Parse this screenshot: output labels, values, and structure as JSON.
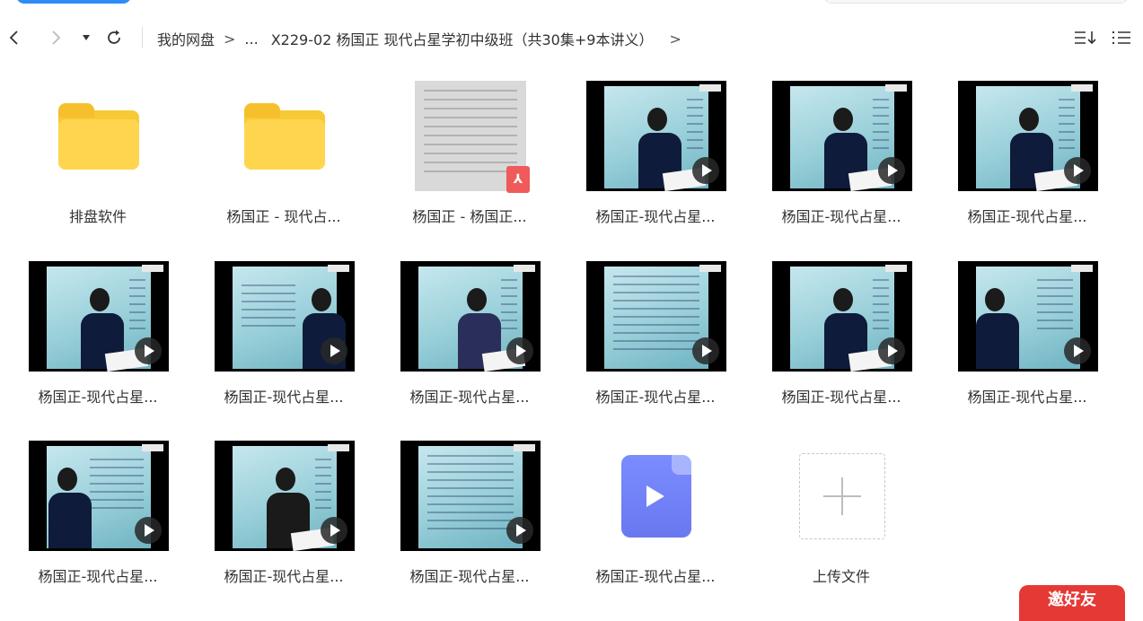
{
  "toolbar": {
    "breadcrumbs": [
      "我的网盘",
      "...",
      "X229-02 杨国正 现代占星学初中级班（共30集+9本讲义）"
    ],
    "crumb_separator": ">",
    "icons": [
      "chevron-left-icon",
      "chevron-right-icon",
      "caret-down-icon",
      "refresh-icon",
      "sort-icon",
      "list-view-icon"
    ]
  },
  "files": [
    {
      "type": "folder",
      "name": "排盘软件"
    },
    {
      "type": "folder",
      "name": "杨国正 - 现代占..."
    },
    {
      "type": "pdf",
      "name": "杨国正 - 杨国正..."
    },
    {
      "type": "video",
      "name": "杨国正-现代占星..."
    },
    {
      "type": "video",
      "name": "杨国正-现代占星..."
    },
    {
      "type": "video",
      "name": "杨国正-现代占星..."
    },
    {
      "type": "video",
      "name": "杨国正-现代占星..."
    },
    {
      "type": "video",
      "name": "杨国正-现代占星..."
    },
    {
      "type": "video",
      "name": "杨国正-现代占星..."
    },
    {
      "type": "video",
      "name": "杨国正-现代占星..."
    },
    {
      "type": "video",
      "name": "杨国正-现代占星..."
    },
    {
      "type": "video",
      "name": "杨国正-现代占星..."
    },
    {
      "type": "video",
      "name": "杨国正-现代占星..."
    },
    {
      "type": "video",
      "name": "杨国正-现代占星..."
    },
    {
      "type": "video",
      "name": "杨国正-现代占星..."
    },
    {
      "type": "video-file",
      "name": "杨国正-现代占星..."
    }
  ],
  "upload": {
    "label": "上传文件"
  },
  "promo": {
    "label": "邀好友"
  },
  "colors": {
    "folder": "#ffd54f",
    "pdf_badge": "#ef5a5a",
    "video_file": "#7b8cff",
    "promo": "#e53935"
  }
}
